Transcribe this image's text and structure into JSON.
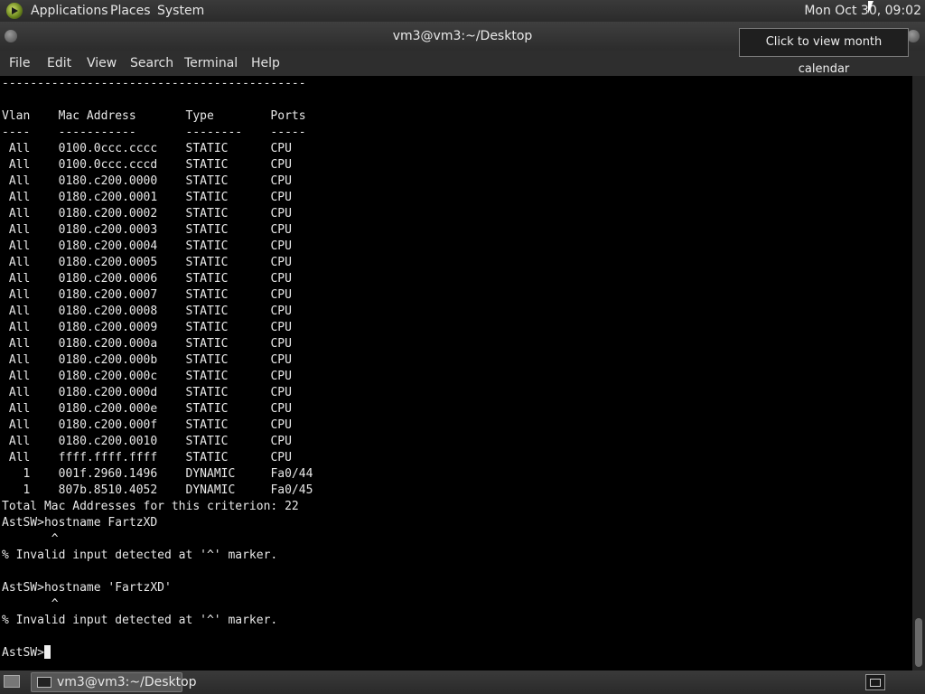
{
  "top_panel": {
    "menus": [
      "Applications",
      "Places",
      "System"
    ],
    "clock": "Mon Oct 30, 09:02"
  },
  "tooltip": {
    "text": "Click to view month calendar"
  },
  "window": {
    "title": "vm3@vm3:~/Desktop",
    "menu": [
      "File",
      "Edit",
      "View",
      "Search",
      "Terminal",
      "Help"
    ]
  },
  "terminal": {
    "separator": "-------------------------------------------",
    "blank": "",
    "header": "Vlan    Mac Address       Type        Ports",
    "underline": "----    -----------       --------    -----",
    "rows": [
      [
        " All",
        "0100.0ccc.cccc",
        "STATIC",
        "CPU"
      ],
      [
        " All",
        "0100.0ccc.cccd",
        "STATIC",
        "CPU"
      ],
      [
        " All",
        "0180.c200.0000",
        "STATIC",
        "CPU"
      ],
      [
        " All",
        "0180.c200.0001",
        "STATIC",
        "CPU"
      ],
      [
        " All",
        "0180.c200.0002",
        "STATIC",
        "CPU"
      ],
      [
        " All",
        "0180.c200.0003",
        "STATIC",
        "CPU"
      ],
      [
        " All",
        "0180.c200.0004",
        "STATIC",
        "CPU"
      ],
      [
        " All",
        "0180.c200.0005",
        "STATIC",
        "CPU"
      ],
      [
        " All",
        "0180.c200.0006",
        "STATIC",
        "CPU"
      ],
      [
        " All",
        "0180.c200.0007",
        "STATIC",
        "CPU"
      ],
      [
        " All",
        "0180.c200.0008",
        "STATIC",
        "CPU"
      ],
      [
        " All",
        "0180.c200.0009",
        "STATIC",
        "CPU"
      ],
      [
        " All",
        "0180.c200.000a",
        "STATIC",
        "CPU"
      ],
      [
        " All",
        "0180.c200.000b",
        "STATIC",
        "CPU"
      ],
      [
        " All",
        "0180.c200.000c",
        "STATIC",
        "CPU"
      ],
      [
        " All",
        "0180.c200.000d",
        "STATIC",
        "CPU"
      ],
      [
        " All",
        "0180.c200.000e",
        "STATIC",
        "CPU"
      ],
      [
        " All",
        "0180.c200.000f",
        "STATIC",
        "CPU"
      ],
      [
        " All",
        "0180.c200.0010",
        "STATIC",
        "CPU"
      ],
      [
        " All",
        "ffff.ffff.ffff",
        "STATIC",
        "CPU"
      ],
      [
        "   1",
        "001f.2960.1496",
        "DYNAMIC",
        "Fa0/44"
      ],
      [
        "   1",
        "807b.8510.4052",
        "DYNAMIC",
        "Fa0/45"
      ]
    ],
    "after_lines": [
      "Total Mac Addresses for this criterion: 22",
      "AstSW>hostname FartzXD",
      "       ^",
      "% Invalid input detected at '^' marker.",
      "",
      "AstSW>hostname 'FartzXD'",
      "       ^",
      "% Invalid input detected at '^' marker.",
      ""
    ],
    "prompt": "AstSW>"
  },
  "taskbar": {
    "task_label": "vm3@vm3:~/Desktop"
  }
}
